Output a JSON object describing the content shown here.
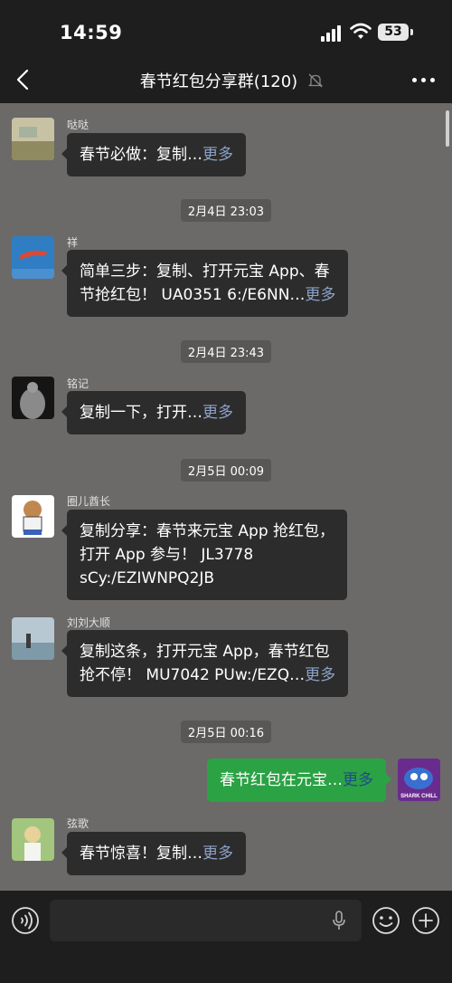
{
  "status_bar": {
    "time": "14:59",
    "battery": "53"
  },
  "nav": {
    "title": "春节红包分享群(120)"
  },
  "messages": [
    {
      "sender": "哒哒",
      "text": "春节必做：复制…",
      "more": "更多"
    },
    {
      "timestamp": "2月4日 23:03"
    },
    {
      "sender": "祥",
      "line1": "简单三步：复制、打开元宝 App、春",
      "line2": "节抢红包！ UA0351 6:/E6NN…",
      "more": "更多"
    },
    {
      "timestamp": "2月4日 23:43"
    },
    {
      "sender": "铭记",
      "text": "复制一下，打开…",
      "more": "更多"
    },
    {
      "timestamp": "2月5日 00:09"
    },
    {
      "sender": "圈儿酋长",
      "line1": "复制分享：春节来元宝 App 抢红包，",
      "line2": "打开 App 参与！ JL3778",
      "line3": "sCy:/EZIWNPQ2JB"
    },
    {
      "sender": "刘刘大顺",
      "line1": "复制这条，打开元宝 App，春节红包",
      "line2": "抢不停！ MU7042 PUw:/EZQ…",
      "more": "更多"
    },
    {
      "timestamp": "2月5日 00:16"
    },
    {
      "self": true,
      "text": "春节红包在元宝…",
      "more": "更多",
      "avatar_text": "SHARK CHILL"
    },
    {
      "sender": "弦歌",
      "text": "春节惊喜！复制…",
      "more": "更多"
    }
  ],
  "colors": {
    "chat_bg": "#6b6a68",
    "bubble_bg": "#2c2c2c",
    "self_bubble_bg": "#2ba244",
    "more_link": "#8ca1c8"
  },
  "icons": [
    "back-arrow",
    "mute-bell",
    "more-dots",
    "voice",
    "microphone",
    "emoji",
    "plus"
  ]
}
